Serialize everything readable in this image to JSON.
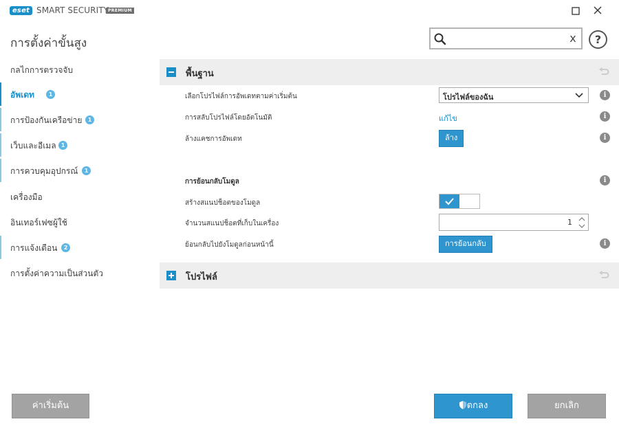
{
  "app": {
    "brand_badge": "eset",
    "brand_name": "SMART SECURITY",
    "brand_edition": "PREMIUM",
    "window_controls": {
      "maximize_icon": "square-icon",
      "close_icon": "x-icon"
    }
  },
  "header": {
    "title": "การตั้งค่าขั้นสูง",
    "search": {
      "value": "",
      "placeholder": "",
      "icon": "search-icon",
      "clear_label": "x"
    },
    "help_label": "?"
  },
  "sidebar": {
    "items": [
      {
        "label": "กลไกการตรวจจับ",
        "badge": null
      },
      {
        "label": "อัพเดท",
        "badge": "1",
        "active": true
      },
      {
        "label": "การป้องกันเครือข่าย",
        "badge": "1"
      },
      {
        "label": "เว็บและอีเมล",
        "badge": "1"
      },
      {
        "label": "การควบคุมอุปกรณ์",
        "badge": "1"
      },
      {
        "label": "เครื่องมือ",
        "badge": null
      },
      {
        "label": "อินเทอร์เฟซผู้ใช้",
        "badge": null
      },
      {
        "label": "การแจ้งเตือน",
        "badge": "2"
      },
      {
        "label": "การตั้งค่าความเป็นส่วนตัว",
        "badge": null
      }
    ]
  },
  "main": {
    "basic": {
      "title": "พื้นฐาน",
      "expanded": true,
      "rows": {
        "default_profile": {
          "label": "เลือกโปรไฟล์การอัพเดทตามค่าเริ่มต้น",
          "value": "โปรไฟล์ของฉัน"
        },
        "auto_switch": {
          "label": "การสลับโปรไฟล์โดยอัตโนมัติ",
          "link": "แก้ไข"
        },
        "clear_cache": {
          "label": "ล้างแคชการอัพเดท",
          "button": "ล้าง"
        },
        "rollback_heading": {
          "label": "การย้อนกลับโมดูล"
        },
        "create_snapshots": {
          "label": "สร้างสแนปช็อตของโมดูล",
          "enabled": true
        },
        "snapshot_count": {
          "label": "จำนวนสแนปช็อตที่เก็บในเครื่อง",
          "value": "1"
        },
        "rollback_previous": {
          "label": "ย้อนกลับไปยังโมดูลก่อนหน้านี้",
          "button": "การย้อนกลับ"
        }
      }
    },
    "profiles": {
      "title": "โปรไฟล์",
      "expanded": false
    }
  },
  "footer": {
    "default_label": "ค่าเริ่มต้น",
    "ok_label": "ตกลง",
    "cancel_label": "ยกเลิก"
  },
  "colors": {
    "accent": "#1a8fc7",
    "button_blue": "#2f95cf",
    "button_grey": "#a3a3a3",
    "badge": "#5db6e4",
    "section_bg": "#eeeeee"
  }
}
